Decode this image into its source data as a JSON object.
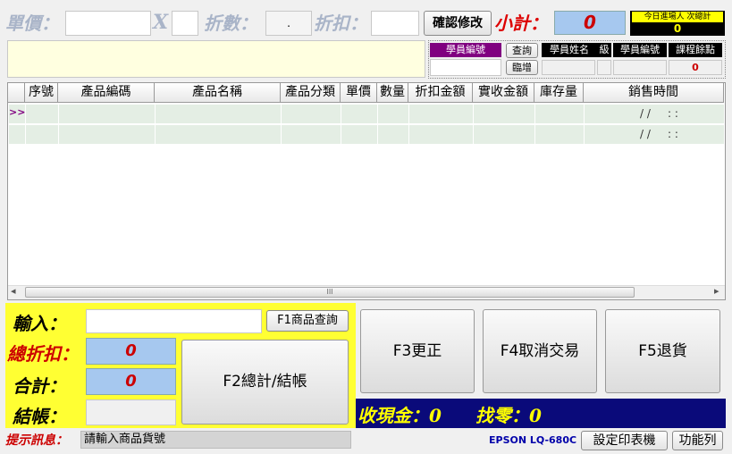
{
  "top": {
    "price_label": "單價：",
    "x_label": "X",
    "count_label": "折數：",
    "count_value": ".",
    "discount_label": "折扣：",
    "confirm_button": "確認修改",
    "subtotal_label": "小計：",
    "subtotal_value": "0",
    "today_label": "今日進場人 次總計",
    "today_value": "0"
  },
  "student": {
    "id_header": "學員編號",
    "query_button": "查詢",
    "name_header": "學員姓名",
    "grade_header": "級",
    "id_header2": "學員編號",
    "points_header": "課程餘點",
    "temp_button": "臨增",
    "points_value": "0"
  },
  "grid": {
    "row_marker": ">>",
    "columns": [
      "序號",
      "產品編碼",
      "產品名稱",
      "產品分類",
      "單價",
      "數量",
      "折扣金額",
      "實收金額",
      "庫存量",
      "銷售時間"
    ],
    "rows": [
      {
        "time": "/ /     : :"
      },
      {
        "time": "/ /     : :"
      }
    ],
    "scroll_left": "◂",
    "scroll_thumb": "III",
    "scroll_right": "▸"
  },
  "bottom": {
    "input_label": "輸入：",
    "f1_button": "F1商品查詢",
    "total_discount_label": "總折扣：",
    "total_discount_value": "0",
    "total_label": "合計：",
    "total_value": "0",
    "checkout_label": "結帳：",
    "f2_button": "F2總計/結帳",
    "f3_button": "F3更正",
    "f4_button": "F4取消交易",
    "f5_button": "F5退貨",
    "cash_label": "收現金：0",
    "change_label": "找零：0",
    "hint_label": "提示訊息：",
    "hint_text": "請輸入商品貨號",
    "printer_label": "EPSON LQ-680C",
    "printer_button": "設定印表機",
    "func_button": "功能列"
  }
}
